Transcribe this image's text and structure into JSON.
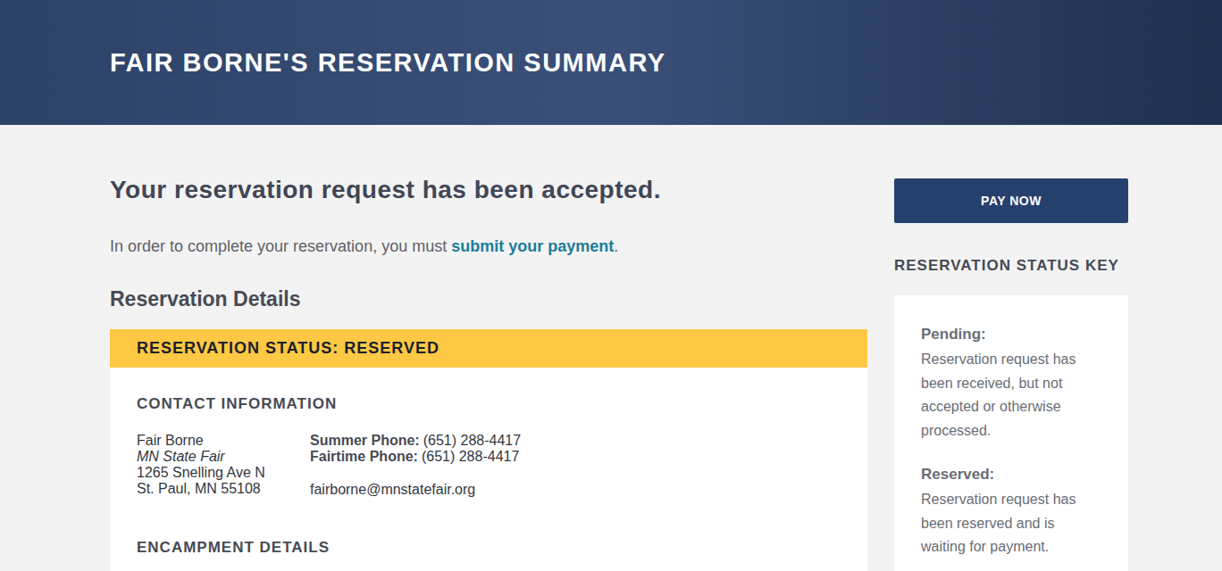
{
  "header": {
    "title": "FAIR BORNE'S RESERVATION SUMMARY"
  },
  "main": {
    "heading": "Your reservation request has been accepted.",
    "intro": {
      "before": "In order to complete your reservation, you must",
      "link": "submit your payment",
      "after": "."
    },
    "section_title": "Reservation Details"
  },
  "status_bar": {
    "label": "RESERVATION STATUS: RESERVED"
  },
  "contact": {
    "title": "CONTACT INFORMATION",
    "address_lines": [
      {
        "text": "Fair Borne",
        "italic": false
      },
      {
        "text": "MN State Fair",
        "italic": true
      },
      {
        "text": "1265 Snelling Ave N",
        "italic": false
      },
      {
        "text": "St. Paul, MN 55108",
        "italic": false
      }
    ],
    "phones": [
      {
        "label": "Summer Phone:",
        "value": "(651) 288-4417"
      },
      {
        "label": "Fairtime Phone:",
        "value": "(651) 288-4417"
      }
    ],
    "email": "fairborne@mnstatefair.org"
  },
  "encampment": {
    "title": "ENCAMPMENT DETAILS"
  },
  "sidebar": {
    "button": "PAY NOW",
    "key_title": "RESERVATION STATUS KEY",
    "key": [
      {
        "term": "Pending:",
        "description": "Reservation request has been received, but not accepted or otherwise processed."
      },
      {
        "term": "Reserved:",
        "description": "Reservation request has been reserved and is waiting for payment."
      }
    ]
  }
}
